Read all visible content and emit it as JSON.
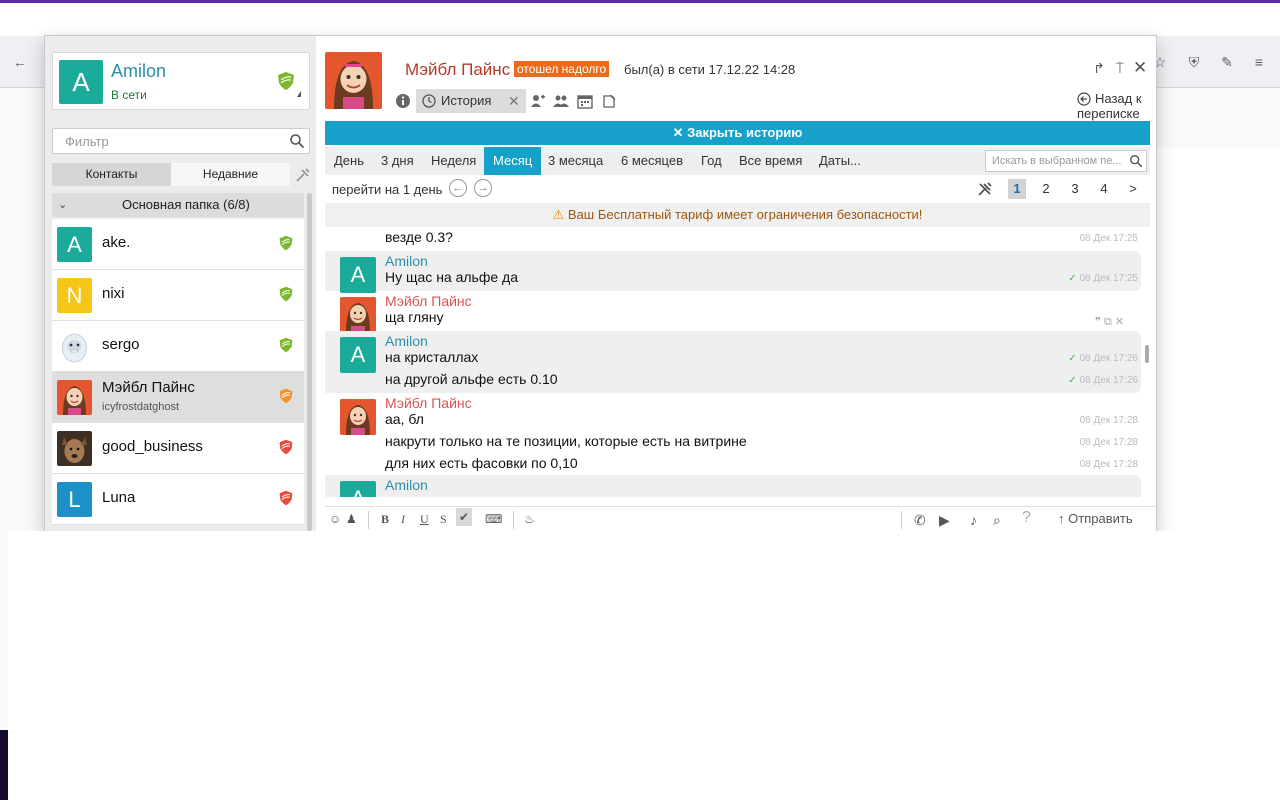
{
  "me": {
    "initial": "A",
    "name": "Amilon",
    "status": "В сети"
  },
  "filter": {
    "placeholder": "Фильтр"
  },
  "left_tabs": {
    "contacts": "Контакты",
    "recent": "Недавние"
  },
  "folder": {
    "label": "Основная папка (6/8)"
  },
  "contacts": [
    {
      "initial": "A",
      "name": "ake.",
      "sub": "",
      "color": "#1bab9b",
      "shield": "#7cb82f"
    },
    {
      "initial": "N",
      "name": "nixi",
      "sub": "",
      "color": "#f5c518",
      "shield": "#7cb82f"
    },
    {
      "initial": "",
      "name": "sergo",
      "sub": "",
      "color": "#ffffff",
      "shield": "#7cb82f"
    },
    {
      "initial": "",
      "name": "Мэйбл Пайнс",
      "sub": "icyfrostdatghost",
      "color": "#e4572e",
      "shield": "#f0932b"
    },
    {
      "initial": "",
      "name": "good_business",
      "sub": "",
      "color": "#5c4033",
      "shield": "#e74c3c"
    },
    {
      "initial": "L",
      "name": "Luna",
      "sub": "",
      "color": "#1e90c8",
      "shield": "#e74c3c"
    }
  ],
  "header": {
    "name": "Мэйбл Пайнс",
    "badge": "отошел надолго",
    "last_seen": "был(а) в сети 17.12.22 14:28"
  },
  "toolbar": {
    "history_tab": "История",
    "back": "Назад к переписке"
  },
  "close_history": "✕ Закрыть историю",
  "periods": [
    "День",
    "3 дня",
    "Неделя",
    "Месяц",
    "3 месяца",
    "6 месяцев",
    "Год",
    "Все время",
    "Даты..."
  ],
  "active_period": "Месяц",
  "history_search": {
    "placeholder": "Искать в выбранном пе..."
  },
  "nav": {
    "goto": "перейти на 1 день",
    "pages": [
      "1",
      "2",
      "3",
      "4",
      ">"
    ]
  },
  "warning": "Ваш Бесплатный тариф имеет ограничения безопасности!",
  "messages": [
    {
      "author": "",
      "text": "везде 0.3?",
      "time": "08 Дек 17:25",
      "read": false
    },
    {
      "author": "Amilon",
      "text": "Ну щас на альфе да",
      "time": "08 Дек 17:25",
      "read": true
    },
    {
      "author": "Мэйбл Пайнс",
      "text": "ща гляну",
      "time": "",
      "read": false
    },
    {
      "author": "Amilon",
      "text": "на кристаллах",
      "time": "08 Дек 17:26",
      "read": true
    },
    {
      "author": "",
      "text": "на другой альфе есть 0.10",
      "time": "08 Дек 17:26",
      "read": true
    },
    {
      "author": "Мэйбл Пайнс",
      "text": "аа, бл",
      "time": "08 Дек 17:28",
      "read": false
    },
    {
      "author": "",
      "text": "накрути только на те позиции, которые есть на витрине",
      "time": "08 Дек 17:28",
      "read": false
    },
    {
      "author": "",
      "text": "для них есть фасовки по 0,10",
      "time": "08 Дек 17:28",
      "read": false
    },
    {
      "author": "Amilon",
      "text": "",
      "time": "",
      "read": false
    }
  ],
  "composer": {
    "send": "Отправить",
    "bold": "B",
    "italic": "I",
    "underline": "U",
    "strike": "S"
  }
}
